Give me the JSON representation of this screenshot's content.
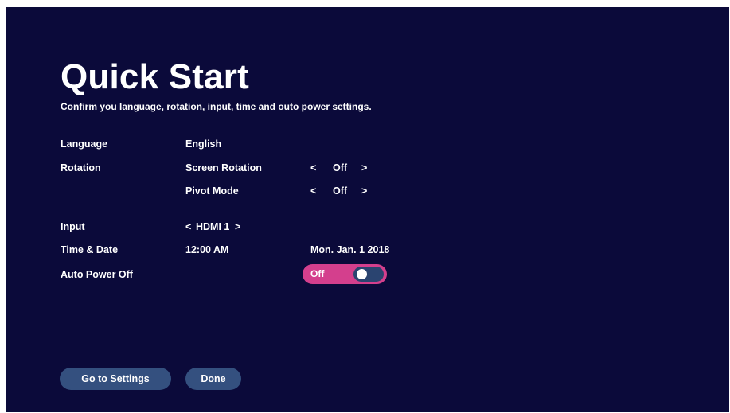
{
  "header": {
    "title": "Quick Start",
    "subtitle": "Confirm you language, rotation, input, time and outo power settings."
  },
  "language": {
    "label": "Language",
    "value": "English"
  },
  "rotation": {
    "label": "Rotation",
    "screen_rotation": {
      "label": "Screen Rotation",
      "prev": "<",
      "value": "Off",
      "next": ">"
    },
    "pivot_mode": {
      "label": "Pivot Mode",
      "prev": "<",
      "value": "Off",
      "next": ">"
    }
  },
  "input": {
    "label": "Input",
    "prev": "<",
    "value": "HDMI 1",
    "next": ">"
  },
  "time_date": {
    "label": "Time & Date",
    "time": "12:00 AM",
    "date": "Mon. Jan. 1 2018"
  },
  "auto_power_off": {
    "label": "Auto Power Off",
    "state_label": "Off",
    "enabled": false
  },
  "buttons": {
    "go_to_settings": "Go to Settings",
    "done": "Done"
  },
  "colors": {
    "background": "#0b0a3a",
    "accent": "#d43f8d",
    "button": "#34507f",
    "toggle_track": "#2a4470",
    "text": "#ffffff"
  }
}
